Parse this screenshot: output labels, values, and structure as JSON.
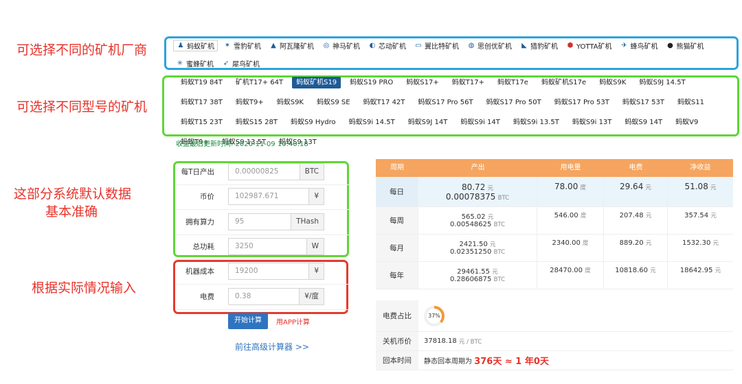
{
  "annotations": {
    "vendor_note": "可选择不同的矿机厂商",
    "model_note": "可选择不同型号的矿机",
    "default_note_1": "这部分系统默认数据",
    "default_note_2": "基本准确",
    "input_note": "根据实际情况输入"
  },
  "colors": {
    "accent": "#1e5a96",
    "table_header": "#f5a55f",
    "annot_red": "#e8332b",
    "green_frame": "#5fd637",
    "blue_frame": "#2aa4dc"
  },
  "vendors": [
    {
      "label": "蚂蚁矿机",
      "icon": "ant-icon"
    },
    {
      "label": "雪豹矿机",
      "icon": "snow-leopard-icon"
    },
    {
      "label": "阿瓦隆矿机",
      "icon": "avalon-icon"
    },
    {
      "label": "神马矿机",
      "icon": "horse-icon"
    },
    {
      "label": "芯动矿机",
      "icon": "core-icon"
    },
    {
      "label": "翼比特矿机",
      "icon": "wing-icon"
    },
    {
      "label": "思创优矿机",
      "icon": "think-icon"
    },
    {
      "label": "猎豹矿机",
      "icon": "cheetah-icon"
    },
    {
      "label": "YOTTA矿机",
      "icon": "yotta-icon"
    },
    {
      "label": "蜂鸟矿机",
      "icon": "hummingbird-icon"
    },
    {
      "label": "熊猫矿机",
      "icon": "panda-icon"
    },
    {
      "label": "蜜蜂矿机",
      "icon": "bee-icon"
    },
    {
      "label": "犀鸟矿机",
      "icon": "hornbill-icon"
    }
  ],
  "models": [
    "蚂蚁T19 84T",
    "矿机T17+ 64T",
    "蚂蚁矿机S19",
    "蚂蚁S19 PRO",
    "蚂蚁S17+",
    "蚂蚁T17+",
    "蚂蚁T17e",
    "蚂蚁矿机S17e",
    "蚂蚁S9K",
    "蚂蚁S9J 14.5T",
    "蚂蚁T17 38T",
    "蚂蚁T9+",
    "蚂蚁S9K",
    "蚂蚁S9 SE",
    "蚂蚁T17 42T",
    "蚂蚁S17 Pro 56T",
    "蚂蚁S17 Pro 50T",
    "蚂蚁S17 Pro 53T",
    "蚂蚁S17 53T",
    "蚂蚁S11",
    "蚂蚁T15 23T",
    "蚂蚁S15 28T",
    "蚂蚁S9 Hydro",
    "蚂蚁S9i 14.5T",
    "蚂蚁S9J 14T",
    "蚂蚁S9i 14T",
    "蚂蚁S9i 13.5T",
    "蚂蚁S9i 13T",
    "蚂蚁S9 14T",
    "蚂蚁V9",
    "蚂蚁T9+",
    "蚂蚁S9 13.5T",
    "蚂蚁S9 13T"
  ],
  "updated": "收益最后更新时间: 2020-11-09 10:40:18",
  "calc": {
    "rows": [
      {
        "label": "每T日产出",
        "value": "0.00000825",
        "unit": "BTC"
      },
      {
        "label": "币价",
        "value": "102987.671",
        "unit": "¥"
      },
      {
        "label": "拥有算力",
        "value": "95",
        "unit": "THash"
      },
      {
        "label": "总功耗",
        "value": "3250",
        "unit": "W"
      },
      {
        "label": "机器成本",
        "value": "19200",
        "unit": "¥"
      },
      {
        "label": "电费",
        "value": "0.38",
        "unit": "¥/度"
      }
    ],
    "start_button": "开始计算",
    "app_link": "用APP计算",
    "advanced_link": "前往高级计算器 >>"
  },
  "table": {
    "headers": [
      "周期",
      "产出",
      "用电量",
      "电费",
      "净收益"
    ],
    "rows": [
      {
        "period": "每日",
        "yield_cny": "80.72",
        "yield_cny_unit": "元",
        "yield_btc": "0.00078375",
        "yield_btc_unit": "BTC",
        "power": "78.00",
        "power_unit": "度",
        "fee": "29.64",
        "fee_unit": "元",
        "net": "51.08",
        "net_unit": "元"
      },
      {
        "period": "每周",
        "yield_cny": "565.02",
        "yield_cny_unit": "元",
        "yield_btc": "0.00548625",
        "yield_btc_unit": "BTC",
        "power": "546.00",
        "power_unit": "度",
        "fee": "207.48",
        "fee_unit": "元",
        "net": "357.54",
        "net_unit": "元"
      },
      {
        "period": "每月",
        "yield_cny": "2421.50",
        "yield_cny_unit": "元",
        "yield_btc": "0.02351250",
        "yield_btc_unit": "BTC",
        "power": "2340.00",
        "power_unit": "度",
        "fee": "889.20",
        "fee_unit": "元",
        "net": "1532.30",
        "net_unit": "元"
      },
      {
        "period": "每年",
        "yield_cny": "29461.55",
        "yield_cny_unit": "元",
        "yield_btc": "0.28606875",
        "yield_btc_unit": "BTC",
        "power": "28470.00",
        "power_unit": "度",
        "fee": "10818.60",
        "fee_unit": "元",
        "net": "18642.95",
        "net_unit": "元"
      }
    ]
  },
  "summary": {
    "fee_ratio_label": "电费占比",
    "fee_ratio": "37%",
    "shutdown_label": "关机币价",
    "shutdown_value": "37818.18",
    "shutdown_unit": "元 / BTC",
    "payback_label": "回本时间",
    "payback_prefix": "静态回本周期为",
    "payback_value": "376天 ≈ 1 年0天"
  }
}
